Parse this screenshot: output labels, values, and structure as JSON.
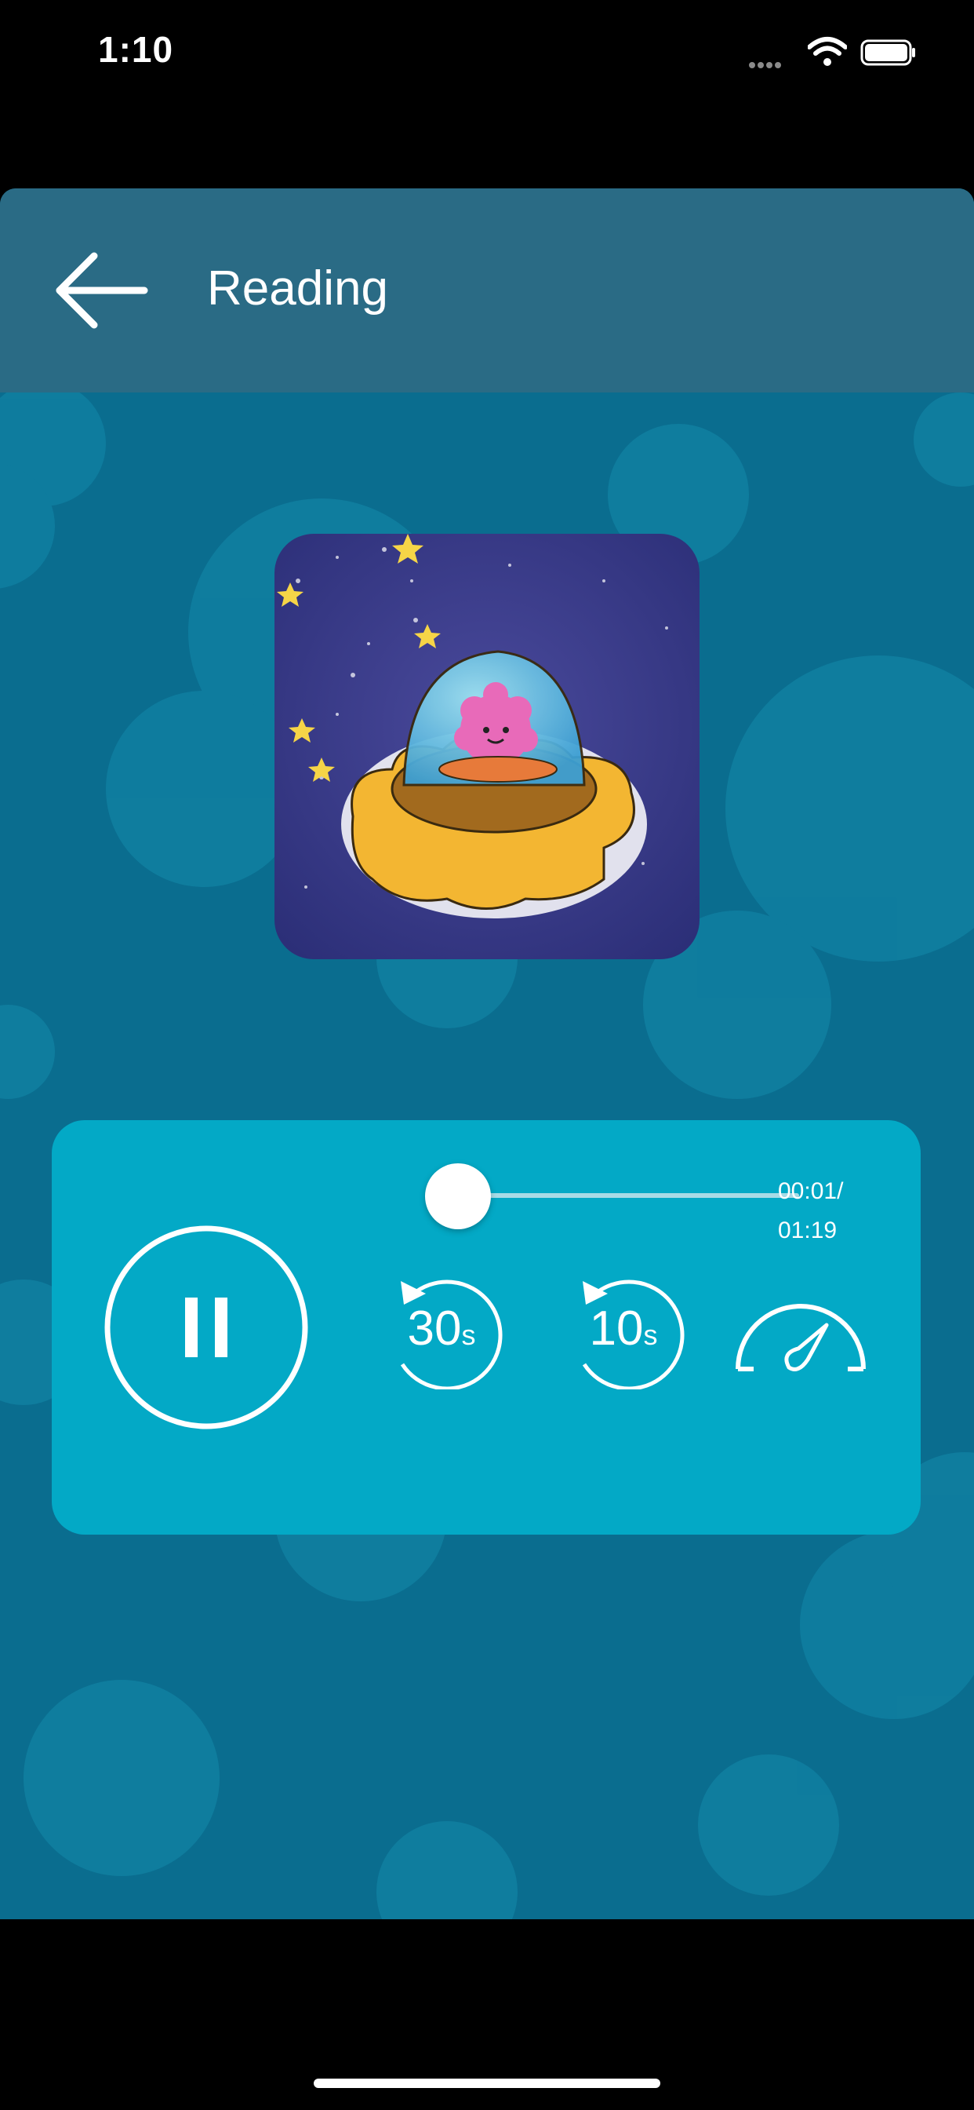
{
  "status_bar": {
    "time": "1:10"
  },
  "header": {
    "title": "Reading"
  },
  "player": {
    "elapsed": "00:01/",
    "total": "01:19",
    "progress": 0.013,
    "rewind_30_label": "30",
    "rewind_10_label": "10",
    "seconds_unit": "s"
  },
  "colors": {
    "background": "#0a6d8f",
    "header": "#2a6b85",
    "card": "#03a9c6",
    "accent": "#ffffff"
  },
  "icons": [
    "back-arrow-icon",
    "pause-icon",
    "rewind-30-icon",
    "rewind-10-icon",
    "speedometer-icon",
    "wifi-icon",
    "battery-icon"
  ]
}
